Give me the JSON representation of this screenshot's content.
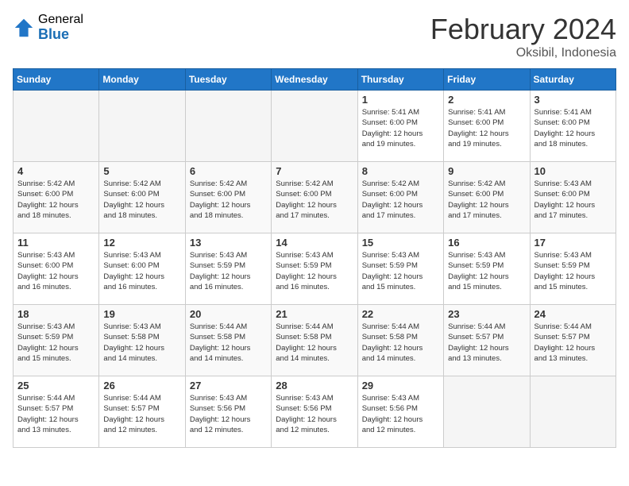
{
  "header": {
    "logo_general": "General",
    "logo_blue": "Blue",
    "title": "February 2024",
    "location": "Oksibil, Indonesia"
  },
  "days_of_week": [
    "Sunday",
    "Monday",
    "Tuesday",
    "Wednesday",
    "Thursday",
    "Friday",
    "Saturday"
  ],
  "weeks": [
    [
      {
        "day": "",
        "info": ""
      },
      {
        "day": "",
        "info": ""
      },
      {
        "day": "",
        "info": ""
      },
      {
        "day": "",
        "info": ""
      },
      {
        "day": "1",
        "info": "Sunrise: 5:41 AM\nSunset: 6:00 PM\nDaylight: 12 hours\nand 19 minutes."
      },
      {
        "day": "2",
        "info": "Sunrise: 5:41 AM\nSunset: 6:00 PM\nDaylight: 12 hours\nand 19 minutes."
      },
      {
        "day": "3",
        "info": "Sunrise: 5:41 AM\nSunset: 6:00 PM\nDaylight: 12 hours\nand 18 minutes."
      }
    ],
    [
      {
        "day": "4",
        "info": "Sunrise: 5:42 AM\nSunset: 6:00 PM\nDaylight: 12 hours\nand 18 minutes."
      },
      {
        "day": "5",
        "info": "Sunrise: 5:42 AM\nSunset: 6:00 PM\nDaylight: 12 hours\nand 18 minutes."
      },
      {
        "day": "6",
        "info": "Sunrise: 5:42 AM\nSunset: 6:00 PM\nDaylight: 12 hours\nand 18 minutes."
      },
      {
        "day": "7",
        "info": "Sunrise: 5:42 AM\nSunset: 6:00 PM\nDaylight: 12 hours\nand 17 minutes."
      },
      {
        "day": "8",
        "info": "Sunrise: 5:42 AM\nSunset: 6:00 PM\nDaylight: 12 hours\nand 17 minutes."
      },
      {
        "day": "9",
        "info": "Sunrise: 5:42 AM\nSunset: 6:00 PM\nDaylight: 12 hours\nand 17 minutes."
      },
      {
        "day": "10",
        "info": "Sunrise: 5:43 AM\nSunset: 6:00 PM\nDaylight: 12 hours\nand 17 minutes."
      }
    ],
    [
      {
        "day": "11",
        "info": "Sunrise: 5:43 AM\nSunset: 6:00 PM\nDaylight: 12 hours\nand 16 minutes."
      },
      {
        "day": "12",
        "info": "Sunrise: 5:43 AM\nSunset: 6:00 PM\nDaylight: 12 hours\nand 16 minutes."
      },
      {
        "day": "13",
        "info": "Sunrise: 5:43 AM\nSunset: 5:59 PM\nDaylight: 12 hours\nand 16 minutes."
      },
      {
        "day": "14",
        "info": "Sunrise: 5:43 AM\nSunset: 5:59 PM\nDaylight: 12 hours\nand 16 minutes."
      },
      {
        "day": "15",
        "info": "Sunrise: 5:43 AM\nSunset: 5:59 PM\nDaylight: 12 hours\nand 15 minutes."
      },
      {
        "day": "16",
        "info": "Sunrise: 5:43 AM\nSunset: 5:59 PM\nDaylight: 12 hours\nand 15 minutes."
      },
      {
        "day": "17",
        "info": "Sunrise: 5:43 AM\nSunset: 5:59 PM\nDaylight: 12 hours\nand 15 minutes."
      }
    ],
    [
      {
        "day": "18",
        "info": "Sunrise: 5:43 AM\nSunset: 5:59 PM\nDaylight: 12 hours\nand 15 minutes."
      },
      {
        "day": "19",
        "info": "Sunrise: 5:43 AM\nSunset: 5:58 PM\nDaylight: 12 hours\nand 14 minutes."
      },
      {
        "day": "20",
        "info": "Sunrise: 5:44 AM\nSunset: 5:58 PM\nDaylight: 12 hours\nand 14 minutes."
      },
      {
        "day": "21",
        "info": "Sunrise: 5:44 AM\nSunset: 5:58 PM\nDaylight: 12 hours\nand 14 minutes."
      },
      {
        "day": "22",
        "info": "Sunrise: 5:44 AM\nSunset: 5:58 PM\nDaylight: 12 hours\nand 14 minutes."
      },
      {
        "day": "23",
        "info": "Sunrise: 5:44 AM\nSunset: 5:57 PM\nDaylight: 12 hours\nand 13 minutes."
      },
      {
        "day": "24",
        "info": "Sunrise: 5:44 AM\nSunset: 5:57 PM\nDaylight: 12 hours\nand 13 minutes."
      }
    ],
    [
      {
        "day": "25",
        "info": "Sunrise: 5:44 AM\nSunset: 5:57 PM\nDaylight: 12 hours\nand 13 minutes."
      },
      {
        "day": "26",
        "info": "Sunrise: 5:44 AM\nSunset: 5:57 PM\nDaylight: 12 hours\nand 12 minutes."
      },
      {
        "day": "27",
        "info": "Sunrise: 5:43 AM\nSunset: 5:56 PM\nDaylight: 12 hours\nand 12 minutes."
      },
      {
        "day": "28",
        "info": "Sunrise: 5:43 AM\nSunset: 5:56 PM\nDaylight: 12 hours\nand 12 minutes."
      },
      {
        "day": "29",
        "info": "Sunrise: 5:43 AM\nSunset: 5:56 PM\nDaylight: 12 hours\nand 12 minutes."
      },
      {
        "day": "",
        "info": ""
      },
      {
        "day": "",
        "info": ""
      }
    ]
  ]
}
